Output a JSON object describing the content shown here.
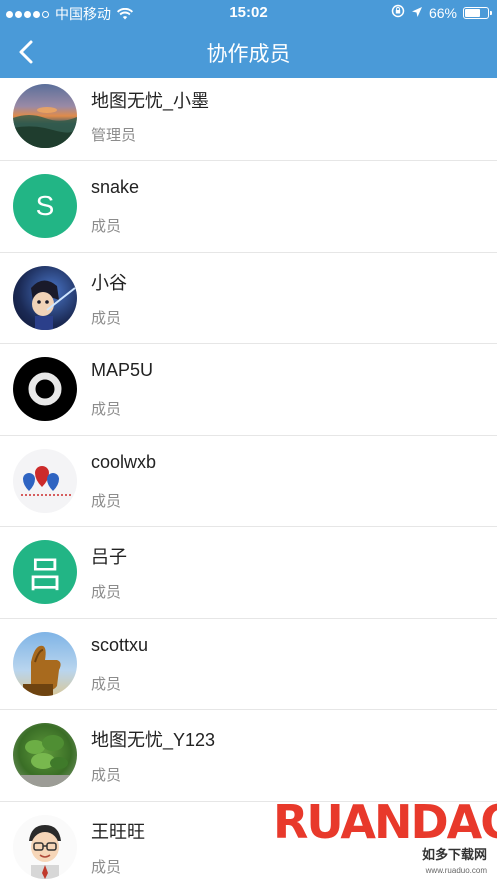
{
  "status_bar": {
    "carrier": "中国移动",
    "time": "15:02",
    "battery": "66%",
    "battery_level": 0.66
  },
  "nav": {
    "title": "协作成员"
  },
  "members": [
    {
      "name": "地图无忧_小墨",
      "role": "管理员",
      "avatar_type": "photo",
      "avatar_icon": "landscape-avatar-icon"
    },
    {
      "name": "snake",
      "role": "成员",
      "avatar_type": "letter",
      "avatar_letter": "S",
      "avatar_color": "#22b585"
    },
    {
      "name": "小谷",
      "role": "成员",
      "avatar_type": "photo",
      "avatar_icon": "anime-character-avatar-icon"
    },
    {
      "name": "MAP5U",
      "role": "成员",
      "avatar_type": "photo",
      "avatar_icon": "black-ring-avatar-icon"
    },
    {
      "name": "coolwxb",
      "role": "成员",
      "avatar_type": "photo",
      "avatar_icon": "map-pins-avatar-icon"
    },
    {
      "name": "吕子",
      "role": "成员",
      "avatar_type": "letter",
      "avatar_letter": "吕",
      "avatar_color": "#22b585"
    },
    {
      "name": "scottxu",
      "role": "成员",
      "avatar_type": "photo",
      "avatar_icon": "thumbs-up-avatar-icon"
    },
    {
      "name": "地图无忧_Y123",
      "role": "成员",
      "avatar_type": "photo",
      "avatar_icon": "plant-avatar-icon"
    },
    {
      "name": "王旺旺",
      "role": "成员",
      "avatar_type": "photo",
      "avatar_icon": "cartoon-face-avatar-icon"
    }
  ],
  "watermark": {
    "brand": "RUANDAO",
    "sub": "如多下载网",
    "url": "www.ruaduo.com"
  },
  "colors": {
    "header": "#4a9ad8",
    "letter_avatar": "#22b585",
    "divider": "#e6e6e6"
  }
}
